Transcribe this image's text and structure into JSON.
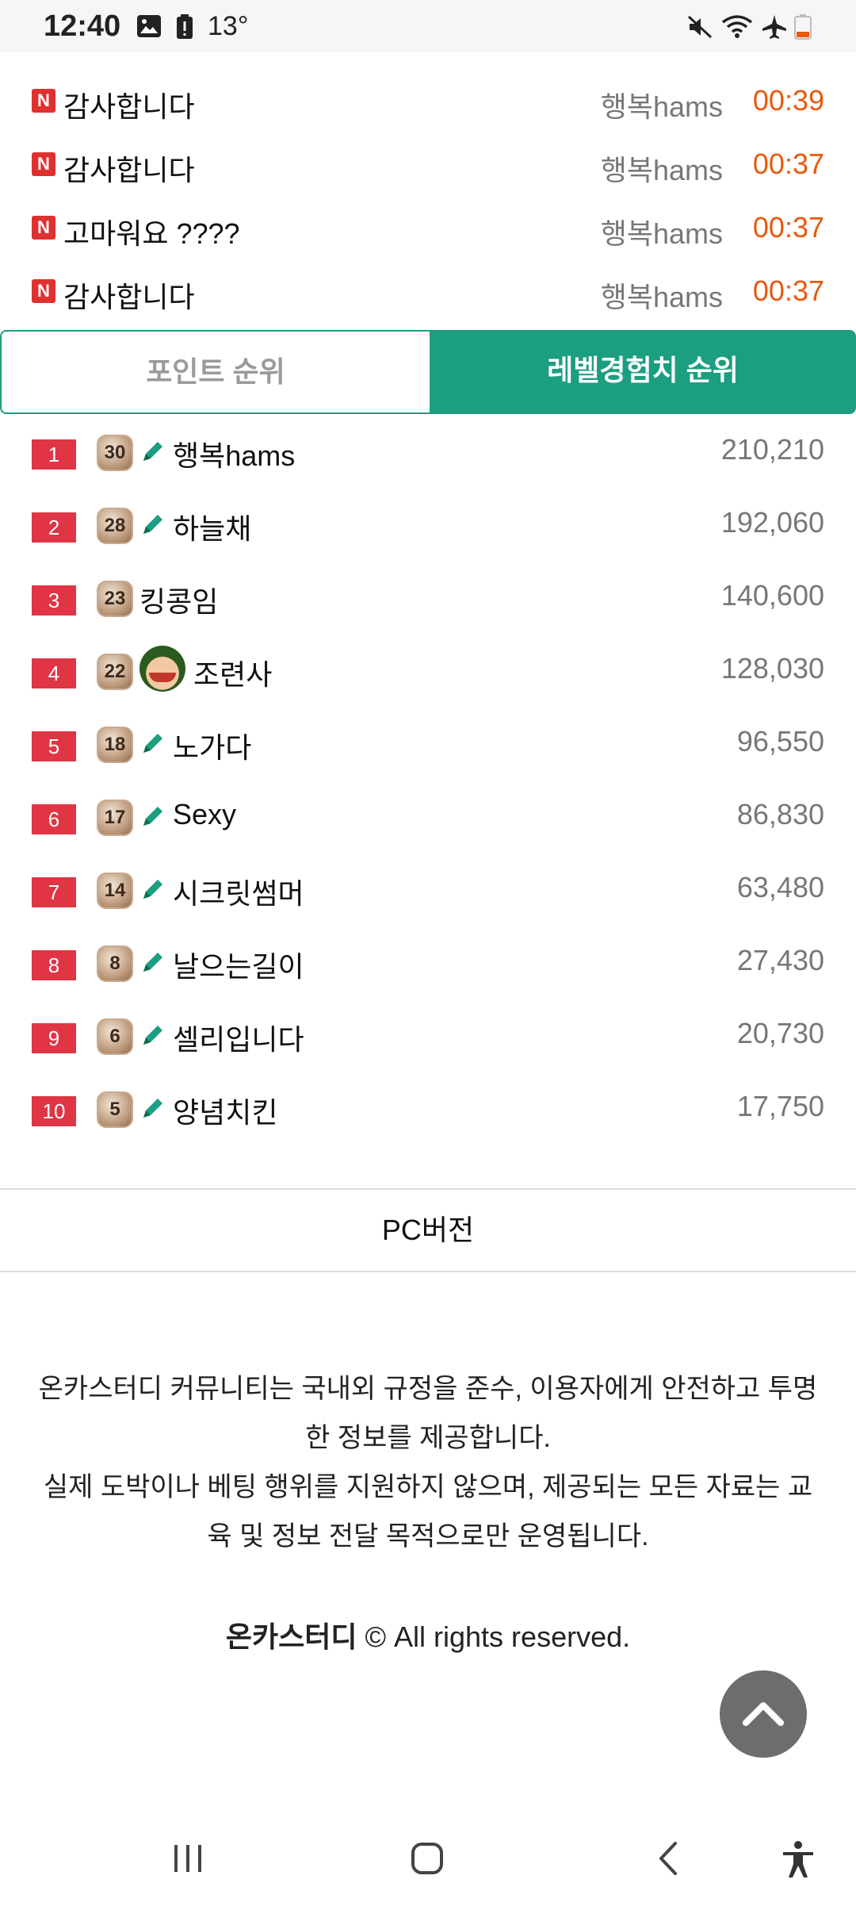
{
  "status_bar": {
    "time": "12:40",
    "temperature": "13°"
  },
  "feed": [
    {
      "badge": "N",
      "title": "감사합니다",
      "user": "행복hams",
      "time": "00:39"
    },
    {
      "badge": "N",
      "title": "감사합니다",
      "user": "행복hams",
      "time": "00:37"
    },
    {
      "badge": "N",
      "title": "고마워요 ????",
      "user": "행복hams",
      "time": "00:37"
    },
    {
      "badge": "N",
      "title": "감사합니다",
      "user": "행복hams",
      "time": "00:37"
    }
  ],
  "tabs": {
    "points": "포인트 순위",
    "level_exp": "레벨경험치 순위"
  },
  "ranking": [
    {
      "rank": "1",
      "level": "30",
      "name": "행복hams",
      "score": "210,210"
    },
    {
      "rank": "2",
      "level": "28",
      "name": "하늘채",
      "score": "192,060"
    },
    {
      "rank": "3",
      "level": "23",
      "name": "킹콩임",
      "score": "140,600"
    },
    {
      "rank": "4",
      "level": "22",
      "name": "조련사",
      "score": "128,030"
    },
    {
      "rank": "5",
      "level": "18",
      "name": "노가다",
      "score": "96,550"
    },
    {
      "rank": "6",
      "level": "17",
      "name": "Sexy",
      "score": "86,830"
    },
    {
      "rank": "7",
      "level": "14",
      "name": "시크릿썸머",
      "score": "63,480"
    },
    {
      "rank": "8",
      "level": "8",
      "name": "날으는길이",
      "score": "27,430"
    },
    {
      "rank": "9",
      "level": "6",
      "name": "셀리입니다",
      "score": "20,730"
    },
    {
      "rank": "10",
      "level": "5",
      "name": "양념치킨",
      "score": "17,750"
    }
  ],
  "pc_version": "PC버전",
  "footer": {
    "line1": "온카스터디 커뮤니티는 국내외 규정을 준수, 이용자에게 안전하고 투명한 정보를 제공합니다.",
    "line2": "실제 도박이나 베팅 행위를 지원하지 않으며, 제공되는 모든 자료는 교육 및 정보 전달 목적으로만 운영됩니다.",
    "brand": "온카스터디",
    "rights": "© All rights reserved."
  },
  "colors": {
    "accent": "#1c9e80",
    "rank_badge": "#e03545",
    "time_orange": "#e8590c"
  }
}
